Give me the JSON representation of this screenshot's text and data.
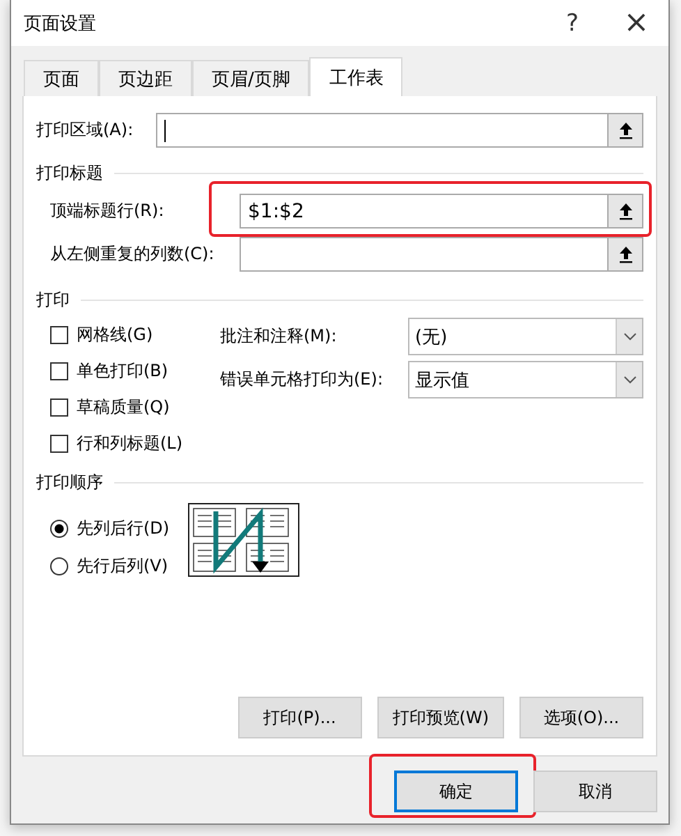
{
  "window": {
    "title": "页面设置",
    "help": "?",
    "close": "×"
  },
  "tabs": [
    {
      "label": "页面",
      "selected": false
    },
    {
      "label": "页边距",
      "selected": false
    },
    {
      "label": "页眉/页脚",
      "selected": false
    },
    {
      "label": "工作表",
      "selected": true
    }
  ],
  "print_area": {
    "label": "打印区域(A):",
    "focused": true
  },
  "print_titles": {
    "heading": "打印标题",
    "rows": [
      {
        "label": "顶端标题行(R):",
        "value": "$1:$2",
        "highlighted": true
      },
      {
        "label": "从左侧重复的列数(C):",
        "highlighted": false
      }
    ]
  },
  "print": {
    "heading": "打印",
    "options": [
      {
        "label": "网格线(G)",
        "checked": false
      },
      {
        "label": "单色打印(B)",
        "checked": false
      },
      {
        "label": "草稿质量(Q)",
        "checked": false
      },
      {
        "label": "行和列标题(L)",
        "checked": false
      }
    ],
    "dropdowns": [
      {
        "label": "批注和注释(M):",
        "value": "(无)"
      },
      {
        "label": "错误单元格打印为(E):",
        "value": "显示值"
      }
    ]
  },
  "print_order": {
    "heading": "打印顺序",
    "options": [
      {
        "label": "先列后行(D)",
        "selected": true
      },
      {
        "label": "先行后列(V)",
        "selected": false
      }
    ]
  },
  "panel_buttons": [
    "打印(P)...",
    "打印预览(W)",
    "选项(O)..."
  ],
  "dialog_buttons": [
    {
      "label": "确定",
      "default": true,
      "highlighted": true
    },
    {
      "label": "取消",
      "default": false,
      "highlighted": false
    }
  ]
}
